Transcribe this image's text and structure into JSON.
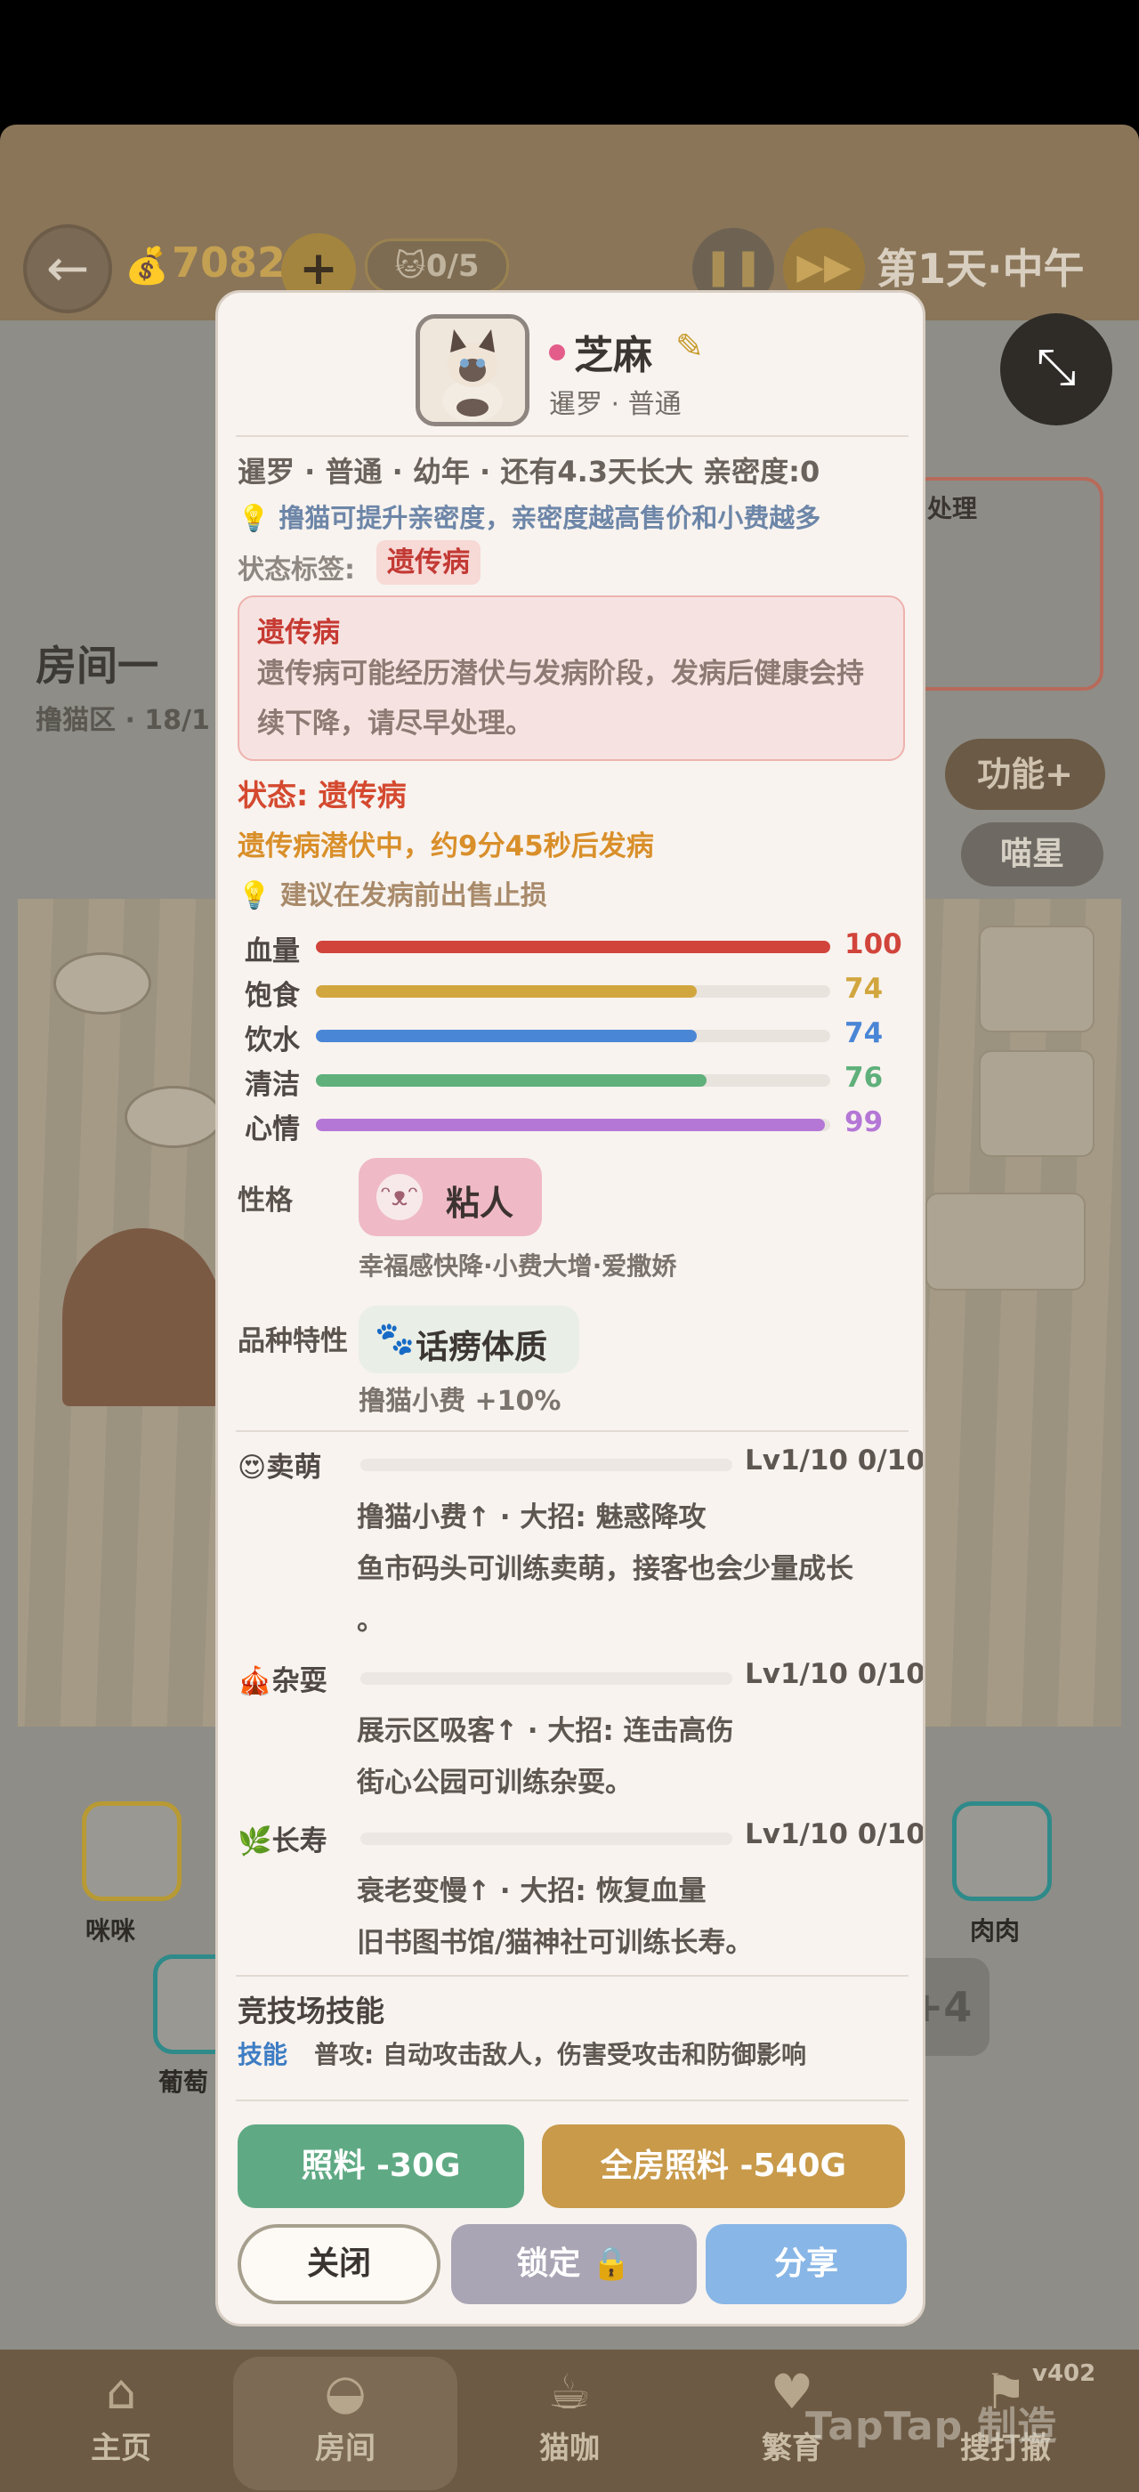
{
  "hud": {
    "money": "7082",
    "plus": "+",
    "cat_count": "0/5",
    "day": "第1天·中午",
    "back": "←"
  },
  "room": {
    "title": "房间一",
    "subtitle": "撸猫区 · 18/1",
    "side_card_text": "处理",
    "function_button": "功能+",
    "miao_button": "喵星",
    "plus_more": "+4",
    "cats": [
      "咪咪",
      "肉肉",
      "葡萄"
    ]
  },
  "nav": {
    "items": [
      {
        "label": "主页",
        "icon": "home-icon"
      },
      {
        "label": "房间",
        "icon": "bowl-icon"
      },
      {
        "label": "猫咖",
        "icon": "cat-cup-icon"
      },
      {
        "label": "繁育",
        "icon": "breed-icon"
      },
      {
        "label": "搜打撤",
        "icon": "search-run-icon"
      }
    ],
    "version": "v402",
    "watermark": "TapTap 制造"
  },
  "cat": {
    "name": "芝麻",
    "breed_line": "暹罗 · 普通",
    "info": "暹罗 · 普通 · 幼年 · 还有4.3天长大  亲密度:0",
    "tip": "撸猫可提升亲密度，亲密度越高售价和小费越多",
    "tag_label": "状态标签:",
    "tag": "遗传病",
    "warning_title": "遗传病",
    "warning_body": "遗传病可能经历潜伏与发病阶段，发病后健康会持续下降，请尽早处理。",
    "status": "状态: 遗传病",
    "latent": "遗传病潜伏中，约9分45秒后发病",
    "advice": "建议在发病前出售止损"
  },
  "stats": [
    {
      "label": "血量",
      "value": 100,
      "color": "#d1443b"
    },
    {
      "label": "饱食",
      "value": 74,
      "color": "#d2a63f"
    },
    {
      "label": "饮水",
      "value": 74,
      "color": "#4a86d6"
    },
    {
      "label": "清洁",
      "value": 76,
      "color": "#5fb07a"
    },
    {
      "label": "心情",
      "value": 99,
      "color": "#b477d6"
    }
  ],
  "personality": {
    "label": "性格",
    "value": "粘人",
    "desc": "幸福感快降·小费大增·爱撒娇"
  },
  "breed_trait": {
    "label": "品种特性",
    "value": "话痨体质",
    "desc": "撸猫小费 +10%"
  },
  "skills": [
    {
      "name": "卖萌",
      "icon": "😍",
      "level": "Lv1/10 0/10",
      "desc1": "撸猫小费↑ · 大招: 魅惑降攻",
      "desc2": "鱼市码头可训练卖萌，接客也会少量成长",
      "desc3": "。"
    },
    {
      "name": "杂耍",
      "icon": "🎪",
      "level": "Lv1/10 0/10",
      "desc1": "展示区吸客↑ · 大招: 连击高伤",
      "desc2": "街心公园可训练杂耍。",
      "desc3": ""
    },
    {
      "name": "长寿",
      "icon": "🌿",
      "level": "Lv1/10 0/10",
      "desc1": "衰老变慢↑ · 大招: 恢复血量",
      "desc2": "旧书图书馆/猫神社可训练长寿。",
      "desc3": ""
    }
  ],
  "arena": {
    "title": "竞技场技能",
    "tag": "技能",
    "text": "普攻: 自动攻击敌人，伤害受攻击和防御影响"
  },
  "buttons": {
    "feed": "照料 -30G",
    "feed_all": "全房照料 -540G",
    "close": "关闭",
    "lock": "锁定 🔒",
    "share": "分享"
  }
}
